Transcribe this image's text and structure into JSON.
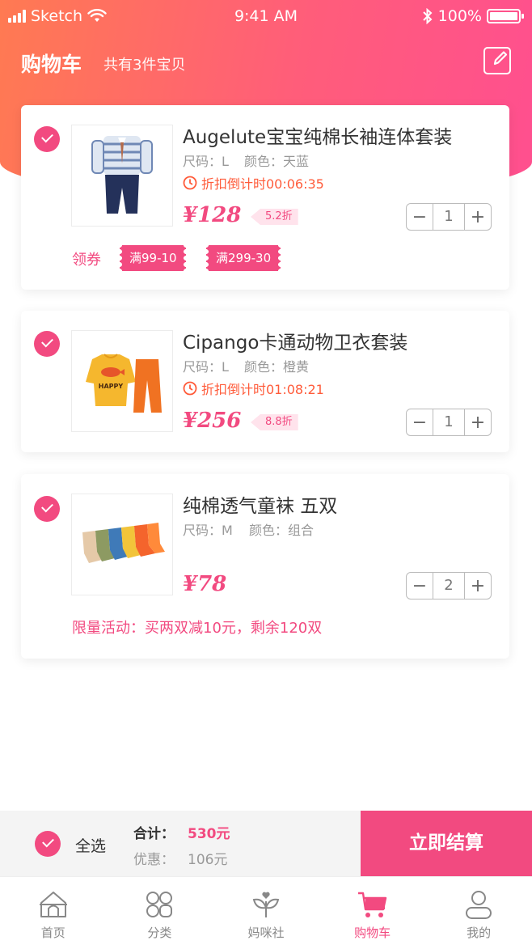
{
  "status_bar": {
    "carrier": "Sketch",
    "time": "9:41 AM",
    "battery": "100%"
  },
  "header": {
    "title": "购物车",
    "subtitle": "共有3件宝贝"
  },
  "items": [
    {
      "name": "Augelute宝宝纯棉长袖连体套装",
      "size_label": "尺码：L",
      "color_label": "颜色：天蓝",
      "countdown": "折扣倒计时00:06:35",
      "price": "¥128",
      "discount": "5.2折",
      "quantity": "1",
      "coupon_label": "领券",
      "coupons": [
        "满99-10",
        "满299-30"
      ]
    },
    {
      "name": "Cipango卡通动物卫衣套装",
      "size_label": "尺码：L",
      "color_label": "颜色：橙黄",
      "countdown": "折扣倒计时01:08:21",
      "price": "¥256",
      "discount": "8.8折",
      "quantity": "1",
      "sweater_text": "HAPPY"
    },
    {
      "name": "纯棉透气童袜 五双",
      "size_label": "尺码：M",
      "color_label": "颜色：组合",
      "price": "¥78",
      "quantity": "2",
      "promo": "限量活动：买两双减10元，剩余120双"
    }
  ],
  "checkout": {
    "select_all": "全选",
    "total_label": "合计：",
    "total_value": "530元",
    "discount_label": "优惠：",
    "discount_value": "106元",
    "pay_button": "立即结算"
  },
  "tabs": [
    {
      "label": "首页",
      "icon": "home-icon"
    },
    {
      "label": "分类",
      "icon": "category-icon"
    },
    {
      "label": "妈咪社",
      "icon": "sprout-icon"
    },
    {
      "label": "购物车",
      "icon": "cart-icon",
      "active": true
    },
    {
      "label": "我的",
      "icon": "user-icon"
    }
  ],
  "colors": {
    "accent": "#f24a80",
    "gradient_start": "#ff7a52",
    "gradient_end": "#ff4f8f",
    "countdown": "#ff5b3a"
  }
}
